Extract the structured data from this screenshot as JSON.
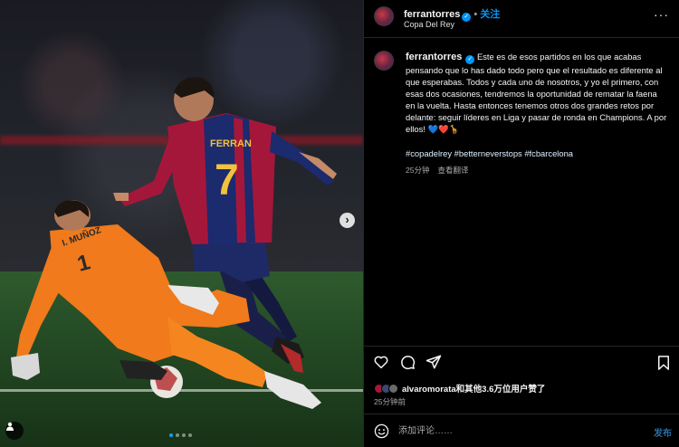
{
  "post": {
    "author": "ferrantorres",
    "follow_label": "关注",
    "separator": "•",
    "location": "Copa Del Rey",
    "more_label": "···"
  },
  "caption": {
    "author": "ferrantorres",
    "text": "Este es de esos partidos en los que acabas pensando que lo has dado todo pero que el resultado es diferente al que esperabas. Todos y cada uno de nosotros, y yo el primero, con esas dos ocasiones, tendremos la oportunidad de rematar la faena en la vuelta. Hasta entonces tenemos otros dos grandes retos por delante: seguir líderes en Liga y pasar de ronda en Champions. A por ellos! 💙❤️🦒",
    "hashtags": "#copadelrey #betterneverstops #fcbarcelona",
    "time": "25分钟",
    "translate_label": "查看翻译"
  },
  "actions": {
    "likes_text": "alvaromorata和其他3.6万位用户赞了",
    "time": "25分钟前"
  },
  "comment": {
    "placeholder": "添加评论……",
    "post_label": "发布"
  },
  "media": {
    "player_name_back": "FERRAN",
    "player_number_back": "7",
    "keeper_name": "I. MUÑOZ",
    "keeper_number": "1",
    "carousel_count": 4,
    "carousel_active": 1,
    "next_icon": "chevron-right-icon"
  },
  "colors": {
    "accent": "#0095f6",
    "barca_blue": "#1c2a6e",
    "barca_red": "#a5173a",
    "keeper_orange": "#f07a1c"
  }
}
